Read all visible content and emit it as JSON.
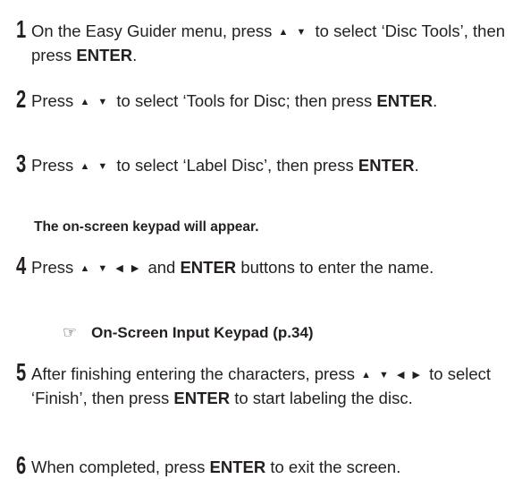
{
  "steps": [
    {
      "number": "1",
      "text_a": "On the Easy Guider menu, press",
      "arrows": "▲ ▼",
      "text_b": "to select ‘Disc Tools’, then press",
      "bold_end": "ENTER",
      "text_end": "."
    },
    {
      "number": "2",
      "text_a": "Press",
      "arrows": "▲ ▼",
      "text_b": "to select ‘Tools for Disc; then press",
      "bold_end": "ENTER",
      "text_end": "."
    },
    {
      "number": "3",
      "text_a": "Press",
      "arrows": "▲ ▼",
      "text_b": "to select ‘Label Disc’, then press",
      "bold_end": "ENTER",
      "text_end": "."
    },
    {
      "number": "4",
      "text_a": "Press",
      "arrows": "▲ ▼ ◀ ▶",
      "text_b": "and",
      "bold_mid": "ENTER",
      "text_c": "buttons to enter the name."
    },
    {
      "number": "5",
      "text_a": "After finishing entering the characters, press",
      "arrows": "▲ ▼ ◀ ▶",
      "text_b": "to select ‘Finish’, then press",
      "bold_mid": "ENTER",
      "text_c": "to start labeling the disc."
    },
    {
      "number": "6",
      "text_a": "When completed, press",
      "bold_mid": "ENTER",
      "text_c": "to exit the screen."
    }
  ],
  "note": "The on-screen keypad will appear.",
  "reference": {
    "icon": "pointing-hand-icon",
    "glyph": "☞",
    "text": "On-Screen Input Keypad (p.34)"
  }
}
